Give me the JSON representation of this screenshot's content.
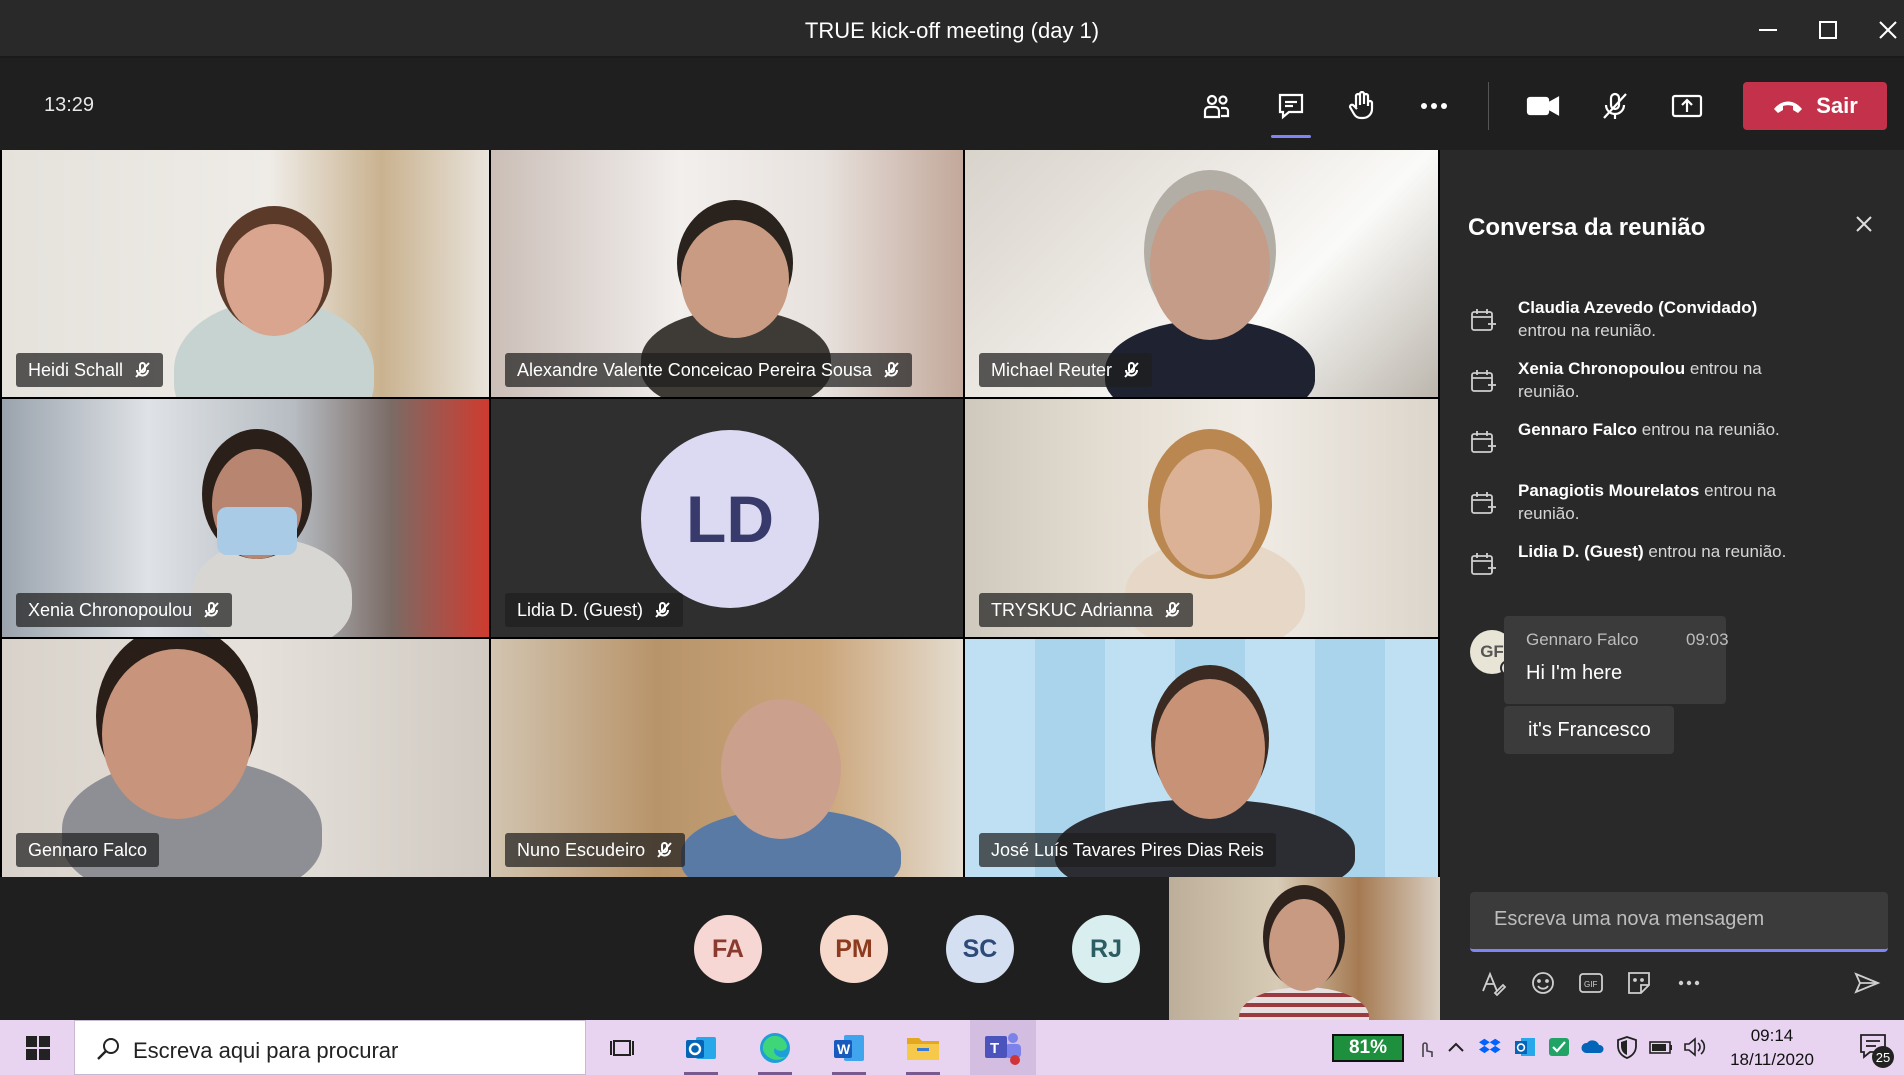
{
  "window": {
    "title": "TRUE kick-off meeting (day 1)"
  },
  "toolbar": {
    "clock": "13:29",
    "leave_label": "Sair"
  },
  "participants": [
    {
      "name": "Heidi Schall",
      "muted": true
    },
    {
      "name": "Alexandre Valente Conceicao Pereira Sousa",
      "muted": true
    },
    {
      "name": "Michael Reuter",
      "muted": true
    },
    {
      "name": "Xenia Chronopoulou",
      "muted": true
    },
    {
      "name": "Lidia D. (Guest)",
      "muted": true,
      "initials": "LD"
    },
    {
      "name": "TRYSKUC Adrianna",
      "muted": true
    },
    {
      "name": "Gennaro Falco",
      "muted": false
    },
    {
      "name": "Nuno Escudeiro",
      "muted": true
    },
    {
      "name": "José Luís Tavares Pires Dias Reis",
      "muted": false
    }
  ],
  "roster": [
    {
      "initials": "FA",
      "bg": "#f6d7d3",
      "fg": "#8a3a2e"
    },
    {
      "initials": "PM",
      "bg": "#f7d9cc",
      "fg": "#8c3b1e"
    },
    {
      "initials": "SC",
      "bg": "#d4e0f2",
      "fg": "#2e4a78"
    },
    {
      "initials": "RJ",
      "bg": "#d9eeee",
      "fg": "#2b5d62"
    }
  ],
  "chat": {
    "title": "Conversa da reunião",
    "events": [
      {
        "name": "Claudia Azevedo (Convidado)",
        "text": "entrou na reunião."
      },
      {
        "name": "Xenia Chronopoulou",
        "text": "entrou na reunião."
      },
      {
        "name": "Gennaro Falco",
        "text": "entrou na reunião."
      },
      {
        "name": "Panagiotis Mourelatos",
        "text": "entrou na reunião."
      },
      {
        "name": "Lidia D. (Guest)",
        "text": "entrou na reunião."
      }
    ],
    "message": {
      "avatar": "GF",
      "author": "Gennaro Falco",
      "time": "09:03",
      "lines": [
        "Hi I'm here",
        "it's Francesco"
      ]
    },
    "compose_placeholder": "Escreva uma nova mensagem"
  },
  "taskbar": {
    "search_placeholder": "Escreva aqui para procurar",
    "battery": "81%",
    "time": "09:14",
    "date": "18/11/2020",
    "notifications": "25"
  },
  "colors": {
    "leave": "#c4314b",
    "accent": "#7f85f5",
    "taskbar": "#e8d3f0"
  }
}
